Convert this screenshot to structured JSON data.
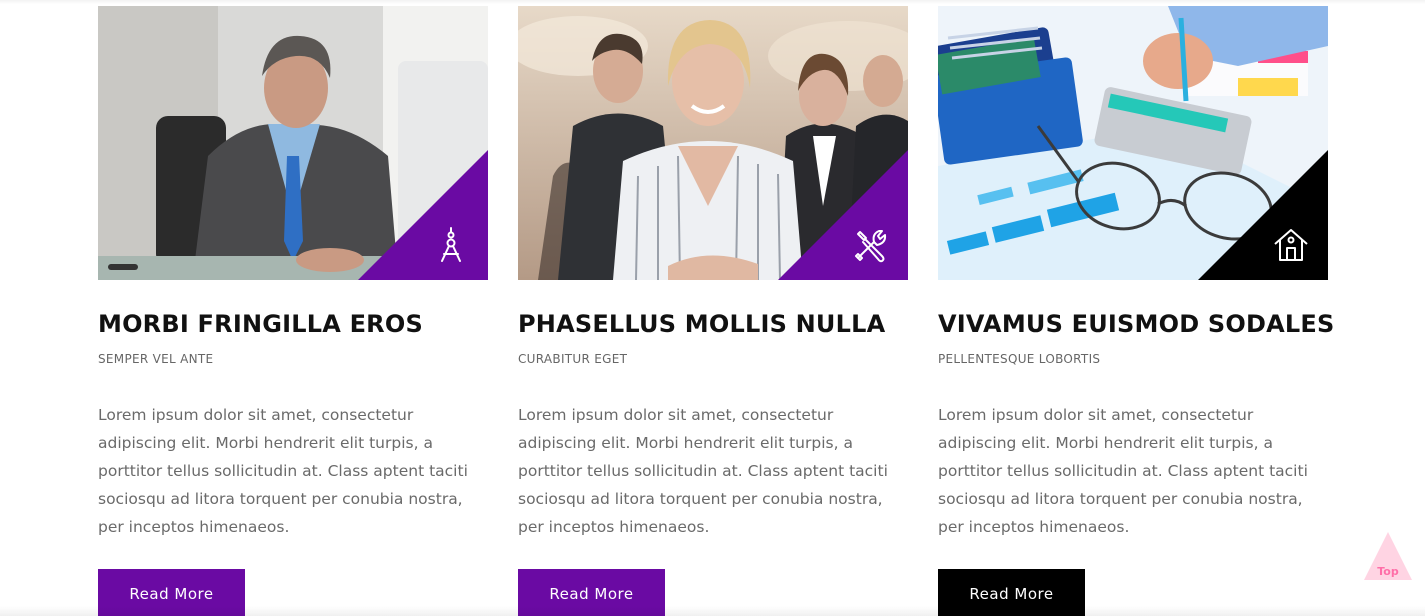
{
  "cards": [
    {
      "title": "MORBI FRINGILLA EROS",
      "subtitle": "SEMPER VEL ANTE",
      "description": "Lorem ipsum dolor sit amet, consectetur adipiscing elit. Morbi hendrerit elit turpis, a porttitor tellus sollicitudin at. Class aptent taciti sociosqu ad litora torquent per conubia nostra, per inceptos himenaeos.",
      "button_label": "Read More",
      "accent_color": "#6a0aa3",
      "icon": "compass-icon",
      "image": "businessman-at-desk-photo"
    },
    {
      "title": "PHASELLUS MOLLIS NULLA",
      "subtitle": "CURABITUR EGET",
      "description": "Lorem ipsum dolor sit amet, consectetur adipiscing elit. Morbi hendrerit elit turpis, a porttitor tellus sollicitudin at. Class aptent taciti sociosqu ad litora torquent per conubia nostra, per inceptos himenaeos.",
      "button_label": "Read More",
      "accent_color": "#6a0aa3",
      "icon": "tools-icon",
      "image": "business-team-photo"
    },
    {
      "title": "VIVAMUS EUISMOD SODALES",
      "subtitle": "PELLENTESQUE LOBORTIS",
      "description": "Lorem ipsum dolor sit amet, consectetur adipiscing elit. Morbi hendrerit elit turpis, a porttitor tellus sollicitudin at. Class aptent taciti sociosqu ad litora torquent per conubia nostra, per inceptos himenaeos.",
      "button_label": "Read More",
      "accent_color": "#000000",
      "icon": "home-icon",
      "image": "finance-charts-calculator-photo"
    }
  ],
  "back_to_top": {
    "label": "Top",
    "color": "#ffb6d0"
  }
}
